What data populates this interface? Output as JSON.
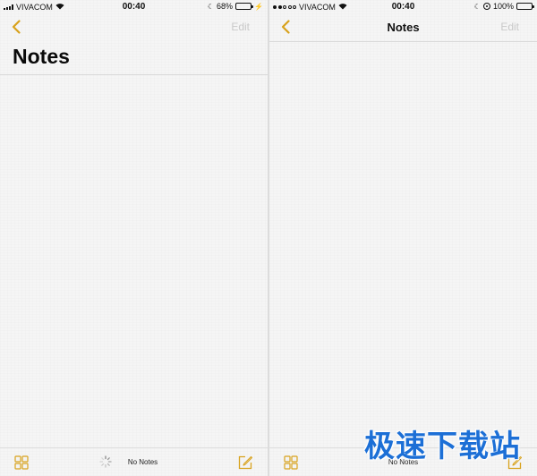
{
  "left_screen": {
    "status": {
      "carrier": "VIVACOM",
      "time": "00:40",
      "battery": "68%"
    },
    "nav": {
      "edit_label": "Edit"
    },
    "large_title": "Notes",
    "toolbar": {
      "count_label": "No Notes"
    }
  },
  "right_screen": {
    "status": {
      "carrier": "VIVACOM",
      "time": "00:40",
      "battery": "100%"
    },
    "nav": {
      "title": "Notes",
      "edit_label": "Edit"
    },
    "toolbar": {
      "count_label": "No Notes"
    }
  },
  "watermark": {
    "text": "极速下载站"
  },
  "icons": {
    "back": "chevron-left-icon",
    "folders": "folders-grid-icon",
    "compose": "compose-icon",
    "loading": "spinner-icon"
  },
  "colors": {
    "accent": "#d8a21c",
    "disabled": "#c9c9c9",
    "battery_green": "#3ec33e",
    "watermark": "#1c6fd6"
  },
  "battery_level": {
    "left": 0.68,
    "right": 1.0
  }
}
